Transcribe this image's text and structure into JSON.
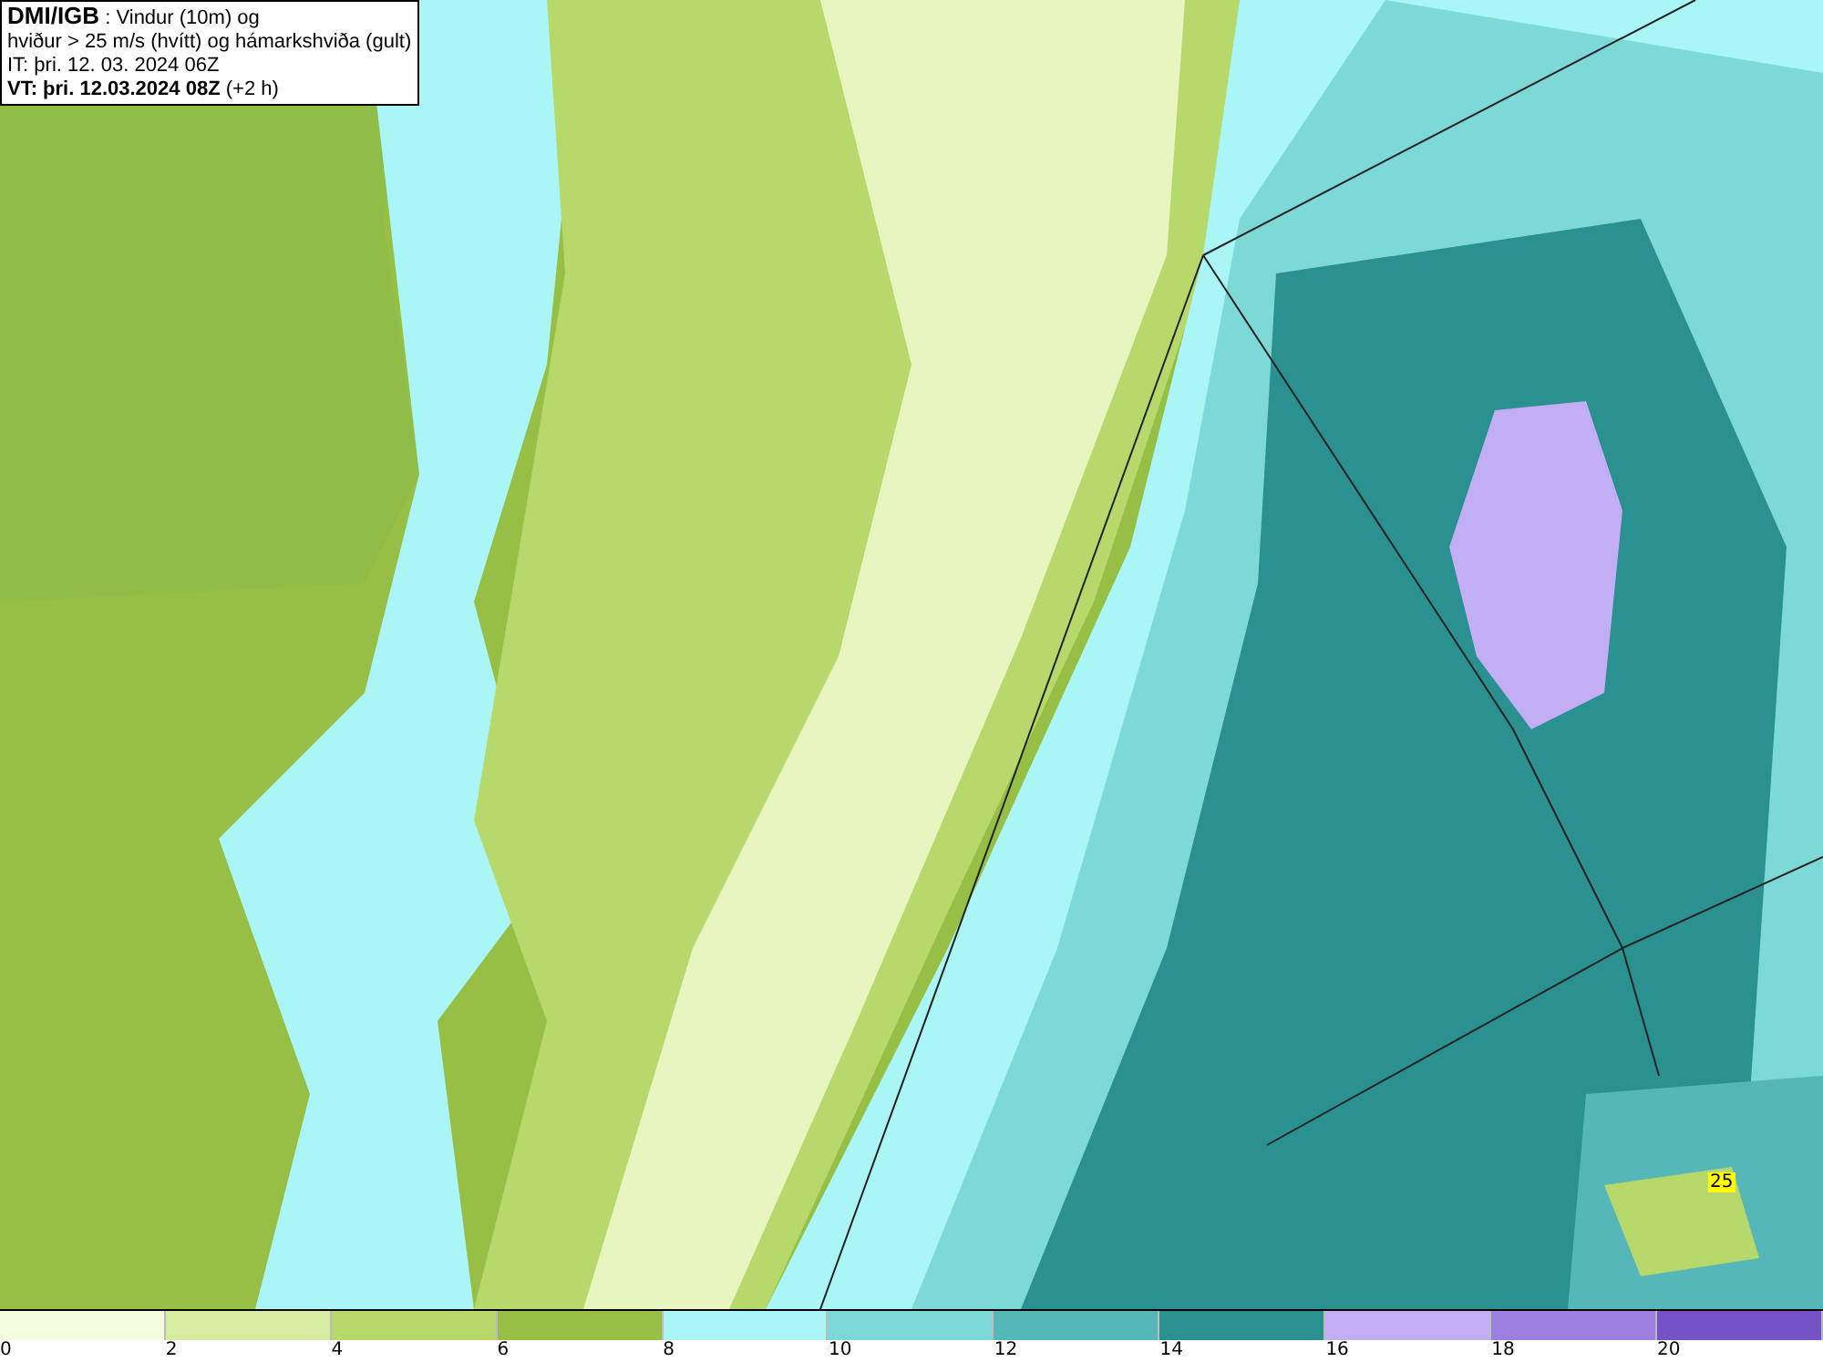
{
  "header": {
    "source": "DMI/IGB",
    "title": ": Vindur (10m) og",
    "subtitle": "hviður > 25 m/s (hvítt) og hámarkshviða (gult)",
    "issue_time": "IT: þri. 12. 03. 2024 06Z",
    "valid_time": "**VT: þri. 12.03.2024 08Z** (+2 h)"
  },
  "map": {
    "gust_label": "25"
  },
  "legend": {
    "bins": [
      {
        "color": "#f5fbdd"
      },
      {
        "color": "#d6eca0"
      },
      {
        "color": "#b7d96b"
      },
      {
        "color": "#97bf45"
      },
      {
        "color": "#aaf6f6"
      },
      {
        "color": "#7dd8d8"
      },
      {
        "color": "#55b7b7"
      },
      {
        "color": "#2a9090"
      },
      {
        "color": "#c2aef5"
      },
      {
        "color": "#9b80e0"
      },
      {
        "color": "#7453c6"
      }
    ],
    "labels": [
      "0",
      "2",
      "4",
      "6",
      "8",
      "10",
      "12",
      "14",
      "16",
      "18",
      "20"
    ]
  }
}
